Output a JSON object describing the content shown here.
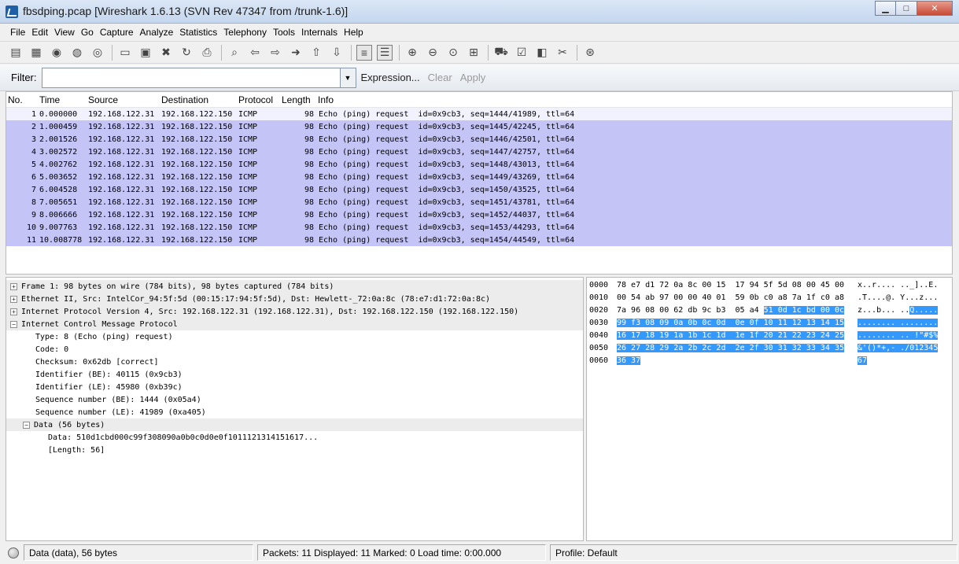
{
  "window": {
    "title": "fbsdping.pcap   [Wireshark 1.6.13  (SVN Rev 47347 from /trunk-1.6)]",
    "minimize": "▁",
    "maximize": "□",
    "close": "✕"
  },
  "menu": [
    "File",
    "Edit",
    "View",
    "Go",
    "Capture",
    "Analyze",
    "Statistics",
    "Telephony",
    "Tools",
    "Internals",
    "Help"
  ],
  "toolbar": {
    "icons": [
      "interface-list-icon",
      "capture-options-icon",
      "start-capture-icon",
      "stop-capture-icon",
      "restart-capture-icon",
      "open-file-icon",
      "save-file-icon",
      "close-file-icon",
      "reload-icon",
      "print-icon",
      "find-packet-icon",
      "go-back-icon",
      "go-forward-icon",
      "go-to-packet-icon",
      "go-first-icon",
      "go-last-icon",
      "colorize-icon",
      "autoscroll-icon",
      "zoom-in-icon",
      "zoom-out-icon",
      "normal-size-icon",
      "resize-columns-icon",
      "capture-filters-icon",
      "display-filters-icon",
      "coloring-rules-icon",
      "preferences-icon",
      "help-icon"
    ]
  },
  "filter": {
    "label": "Filter:",
    "value": "",
    "expression": "Expression...",
    "clear": "Clear",
    "apply": "Apply"
  },
  "packet_list": {
    "columns": [
      "No.",
      "Time",
      "Source",
      "Destination",
      "Protocol",
      "Length",
      "Info"
    ],
    "rows": [
      {
        "no": "1",
        "time": "0.000000",
        "src": "192.168.122.31",
        "dst": "192.168.122.150",
        "proto": "ICMP",
        "len": "98",
        "info": "Echo (ping) request  id=0x9cb3, seq=1444/41989, ttl=64"
      },
      {
        "no": "2",
        "time": "1.000459",
        "src": "192.168.122.31",
        "dst": "192.168.122.150",
        "proto": "ICMP",
        "len": "98",
        "info": "Echo (ping) request  id=0x9cb3, seq=1445/42245, ttl=64"
      },
      {
        "no": "3",
        "time": "2.001526",
        "src": "192.168.122.31",
        "dst": "192.168.122.150",
        "proto": "ICMP",
        "len": "98",
        "info": "Echo (ping) request  id=0x9cb3, seq=1446/42501, ttl=64"
      },
      {
        "no": "4",
        "time": "3.002572",
        "src": "192.168.122.31",
        "dst": "192.168.122.150",
        "proto": "ICMP",
        "len": "98",
        "info": "Echo (ping) request  id=0x9cb3, seq=1447/42757, ttl=64"
      },
      {
        "no": "5",
        "time": "4.002762",
        "src": "192.168.122.31",
        "dst": "192.168.122.150",
        "proto": "ICMP",
        "len": "98",
        "info": "Echo (ping) request  id=0x9cb3, seq=1448/43013, ttl=64"
      },
      {
        "no": "6",
        "time": "5.003652",
        "src": "192.168.122.31",
        "dst": "192.168.122.150",
        "proto": "ICMP",
        "len": "98",
        "info": "Echo (ping) request  id=0x9cb3, seq=1449/43269, ttl=64"
      },
      {
        "no": "7",
        "time": "6.004528",
        "src": "192.168.122.31",
        "dst": "192.168.122.150",
        "proto": "ICMP",
        "len": "98",
        "info": "Echo (ping) request  id=0x9cb3, seq=1450/43525, ttl=64"
      },
      {
        "no": "8",
        "time": "7.005651",
        "src": "192.168.122.31",
        "dst": "192.168.122.150",
        "proto": "ICMP",
        "len": "98",
        "info": "Echo (ping) request  id=0x9cb3, seq=1451/43781, ttl=64"
      },
      {
        "no": "9",
        "time": "8.006666",
        "src": "192.168.122.31",
        "dst": "192.168.122.150",
        "proto": "ICMP",
        "len": "98",
        "info": "Echo (ping) request  id=0x9cb3, seq=1452/44037, ttl=64"
      },
      {
        "no": "10",
        "time": "9.007763",
        "src": "192.168.122.31",
        "dst": "192.168.122.150",
        "proto": "ICMP",
        "len": "98",
        "info": "Echo (ping) request  id=0x9cb3, seq=1453/44293, ttl=64"
      },
      {
        "no": "11",
        "time": "10.008778",
        "src": "192.168.122.31",
        "dst": "192.168.122.150",
        "proto": "ICMP",
        "len": "98",
        "info": "Echo (ping) request  id=0x9cb3, seq=1454/44549, ttl=64"
      }
    ],
    "row_color": "#c4c4f7"
  },
  "details": {
    "top": [
      {
        "toggle": "+",
        "text": "Frame 1: 98 bytes on wire (784 bits), 98 bytes captured (784 bits)"
      },
      {
        "toggle": "+",
        "text": "Ethernet II, Src: IntelCor_94:5f:5d (00:15:17:94:5f:5d), Dst: Hewlett-_72:0a:8c (78:e7:d1:72:0a:8c)"
      },
      {
        "toggle": "+",
        "text": "Internet Protocol Version 4, Src: 192.168.122.31 (192.168.122.31), Dst: 192.168.122.150 (192.168.122.150)"
      },
      {
        "toggle": "−",
        "text": "Internet Control Message Protocol"
      }
    ],
    "icmp_fields": [
      "Type: 8 (Echo (ping) request)",
      "Code: 0",
      "Checksum: 0x62db [correct]",
      "Identifier (BE): 40115 (0x9cb3)",
      "Identifier (LE): 45980 (0xb39c)",
      "Sequence number (BE): 1444 (0x05a4)",
      "Sequence number (LE): 41989 (0xa405)"
    ],
    "data_node": {
      "toggle": "−",
      "text": "Data (56 bytes)"
    },
    "data_fields": [
      "Data: 510d1cbd000c99f308090a0b0c0d0e0f1011121314151617...",
      "[Length: 56]"
    ]
  },
  "hex": {
    "rows": [
      {
        "off": "0000",
        "b": "78 e7 d1 72 0a 8c 00 15  17 94 5f 5d 08 00 45 00",
        "bh": "",
        "a": "x..r.... .._]..E.",
        "ah": ""
      },
      {
        "off": "0010",
        "b": "00 54 ab 97 00 00 40 01  59 0b c0 a8 7a 1f c0 a8",
        "bh": "",
        "a": ".T....@. Y...z...",
        "ah": ""
      },
      {
        "off": "0020",
        "b": "7a 96 08 00 62 db 9c b3  05 a4 ",
        "bh": "51 0d 1c bd 00 0c",
        "a": "z...b... ..",
        "ah": "Q....."
      },
      {
        "off": "0030",
        "b": "",
        "bh": "99 f3 08 09 0a 0b 0c 0d  0e 0f 10 11 12 13 14 15",
        "a": "",
        "ah": "........ ........"
      },
      {
        "off": "0040",
        "b": "",
        "bh": "16 17 18 19 1a 1b 1c 1d  1e 1f 20 21 22 23 24 25",
        "a": "",
        "ah": "........ .. !\"#$%"
      },
      {
        "off": "0050",
        "b": "",
        "bh": "26 27 28 29 2a 2b 2c 2d  2e 2f 30 31 32 33 34 35",
        "a": "",
        "ah": "&'()*+,- ./012345"
      },
      {
        "off": "0060",
        "b": "",
        "bh": "36 37",
        "a": "",
        "ah": "67"
      }
    ],
    "highlight_color": "#3399ff"
  },
  "status": {
    "field": "Data (data), 56 bytes",
    "packets": "Packets: 11 Displayed: 11 Marked: 0 Load time: 0:00.000",
    "profile": "Profile: Default"
  }
}
